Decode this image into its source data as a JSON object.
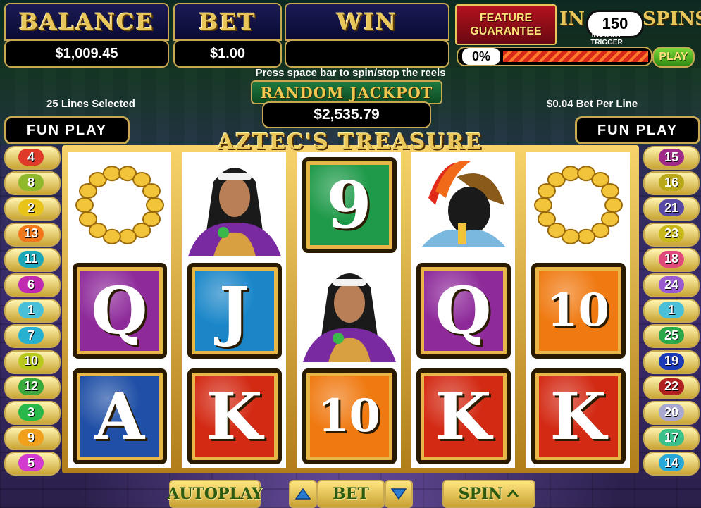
{
  "meters": {
    "balance": {
      "title": "BALANCE",
      "value": "$1,009.45"
    },
    "bet": {
      "title": "BET",
      "value": "$1.00"
    },
    "win": {
      "title": "WIN",
      "value": ""
    }
  },
  "feature": {
    "label_line1": "FEATURE",
    "label_line2": "GUARANTEE",
    "in": "IN",
    "count": "150",
    "spins": "SPINS",
    "note_line1": "INSTANT",
    "note_line2": "TRIGGER CHANCE",
    "progress": "0%",
    "play": "PLAY"
  },
  "hint": "Press space bar to spin/stop the reels",
  "lines_selected": "25 Lines Selected",
  "bet_per_line": "$0.04 Bet Per Line",
  "jackpot": {
    "title": "RANDOM JACKPOT",
    "value": "$2,535.79"
  },
  "fun_play": {
    "left": "FUN PLAY",
    "right": "FUN PLAY"
  },
  "game_title": "AZTEC'S TREASURE",
  "reels": [
    [
      {
        "sym": "necklace-icon"
      },
      {
        "sym": "Q",
        "color": "#8e2a9a"
      },
      {
        "sym": "A",
        "color": "#1f4fa6"
      }
    ],
    [
      {
        "sym": "woman-icon"
      },
      {
        "sym": "J",
        "color": "#1a86c8"
      },
      {
        "sym": "K",
        "color": "#d32a14"
      }
    ],
    [
      {
        "sym": "9",
        "color": "#1f9a4a"
      },
      {
        "sym": "woman-icon"
      },
      {
        "sym": "10",
        "color": "#f07a12"
      }
    ],
    [
      {
        "sym": "warrior-helmet-icon"
      },
      {
        "sym": "Q",
        "color": "#8e2a9a"
      },
      {
        "sym": "K",
        "color": "#d32a14"
      }
    ],
    [
      {
        "sym": "necklace-icon"
      },
      {
        "sym": "10",
        "color": "#f07a12"
      },
      {
        "sym": "K",
        "color": "#d32a14"
      }
    ]
  ],
  "paylines_left": [
    {
      "n": "4",
      "color": "#e03a2a"
    },
    {
      "n": "8",
      "color": "#8fb82a"
    },
    {
      "n": "2",
      "color": "#e8c41a"
    },
    {
      "n": "13",
      "color": "#f0781a"
    },
    {
      "n": "11",
      "color": "#1fa8b8"
    },
    {
      "n": "6",
      "color": "#c02ab0"
    },
    {
      "n": "1",
      "color": "#4ac0d8"
    },
    {
      "n": "7",
      "color": "#28b0d0"
    },
    {
      "n": "10",
      "color": "#b8c81a"
    },
    {
      "n": "12",
      "color": "#3aa83a"
    },
    {
      "n": "3",
      "color": "#2ab84a"
    },
    {
      "n": "9",
      "color": "#f0a01a"
    },
    {
      "n": "5",
      "color": "#d23ad0"
    }
  ],
  "paylines_right": [
    {
      "n": "15",
      "color": "#a02a8a"
    },
    {
      "n": "16",
      "color": "#b8a81a"
    },
    {
      "n": "21",
      "color": "#5a4aa8"
    },
    {
      "n": "23",
      "color": "#c8b81a"
    },
    {
      "n": "18",
      "color": "#e04a7a"
    },
    {
      "n": "24",
      "color": "#9a5ad0"
    },
    {
      "n": "1",
      "color": "#4ac0d8"
    },
    {
      "n": "25",
      "color": "#2aa84a"
    },
    {
      "n": "19",
      "color": "#1a3ab8"
    },
    {
      "n": "22",
      "color": "#b02020"
    },
    {
      "n": "20",
      "color": "#a8a8d0"
    },
    {
      "n": "17",
      "color": "#3ac08a"
    },
    {
      "n": "14",
      "color": "#28a8d8"
    }
  ],
  "controls": {
    "autoplay": "AUTOPLAY",
    "bet": "BET",
    "spin": "SPIN"
  }
}
